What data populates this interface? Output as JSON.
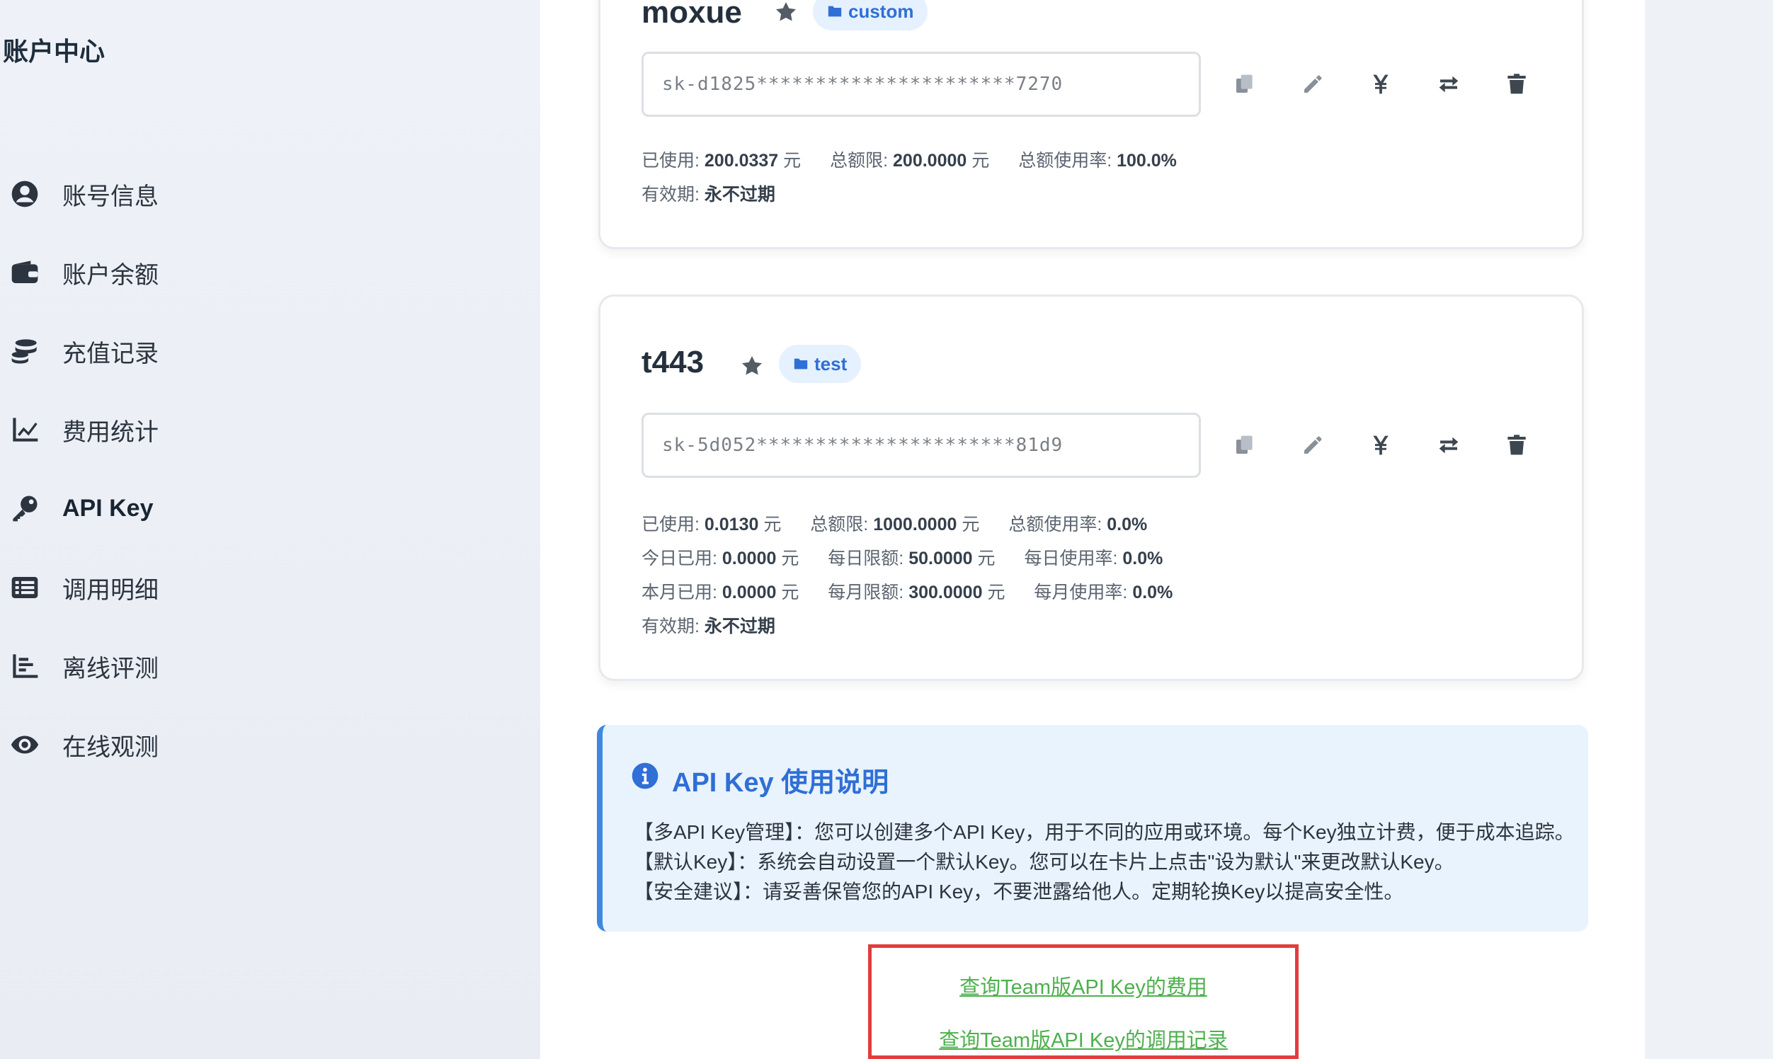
{
  "sidebar": {
    "title": "账户中心",
    "items": [
      {
        "label": "账号信息",
        "icon": "user-circle-icon"
      },
      {
        "label": "账户余额",
        "icon": "wallet-icon"
      },
      {
        "label": "充值记录",
        "icon": "coins-icon"
      },
      {
        "label": "费用统计",
        "icon": "line-chart-icon"
      },
      {
        "label": "API Key",
        "icon": "key-icon",
        "active": true
      },
      {
        "label": "调用明细",
        "icon": "list-icon"
      },
      {
        "label": "离线评测",
        "icon": "bar-chart-icon"
      },
      {
        "label": "在线观测",
        "icon": "eye-icon"
      }
    ]
  },
  "keys": [
    {
      "name": "moxue",
      "tag": "custom",
      "masked_key": "sk-d1825**********************7270",
      "stats": {
        "used_label": "已使用:",
        "used_value": "200.0337",
        "unit": "元",
        "limit_label": "总额限:",
        "limit_value": "200.0000",
        "rate_label": "总额使用率:",
        "rate_value": "100.0%",
        "expiry_label": "有效期:",
        "expiry_value": "永不过期"
      }
    },
    {
      "name": "t443",
      "tag": "test",
      "masked_key": "sk-5d052**********************81d9",
      "stats": {
        "used_label": "已使用:",
        "used_value": "0.0130",
        "unit": "元",
        "limit_label": "总额限:",
        "limit_value": "1000.0000",
        "rate_label": "总额使用率:",
        "rate_value": "0.0%",
        "today_label": "今日已用:",
        "today_value": "0.0000",
        "daily_limit_label": "每日限额:",
        "daily_limit_value": "50.0000",
        "daily_rate_label": "每日使用率:",
        "daily_rate_value": "0.0%",
        "month_label": "本月已用:",
        "month_value": "0.0000",
        "monthly_limit_label": "每月限额:",
        "monthly_limit_value": "300.0000",
        "monthly_rate_label": "每月使用率:",
        "monthly_rate_value": "0.0%",
        "expiry_label": "有效期:",
        "expiry_value": "永不过期"
      }
    }
  ],
  "actions": [
    "copy-icon",
    "edit-icon",
    "yuan-icon",
    "swap-icon",
    "trash-icon"
  ],
  "info": {
    "title": "API Key 使用说明",
    "lines": [
      "【多API Key管理】：您可以创建多个API Key，用于不同的应用或环境。每个Key独立计费，便于成本追踪。",
      "【默认Key】：系统会自动设置一个默认Key。您可以在卡片上点击\"设为默认\"来更改默认Key。",
      "【安全建议】：请妥善保管您的API Key，不要泄露给他人。定期轮换Key以提高安全性。"
    ]
  },
  "team_links": {
    "cost": "查询Team版API Key的费用",
    "calls": "查询Team版API Key的调用记录"
  },
  "colors": {
    "accent": "#2f6fd6",
    "info_bg": "#e8f3fd",
    "link": "#4db04d",
    "highlight_border": "#e23c3c"
  }
}
